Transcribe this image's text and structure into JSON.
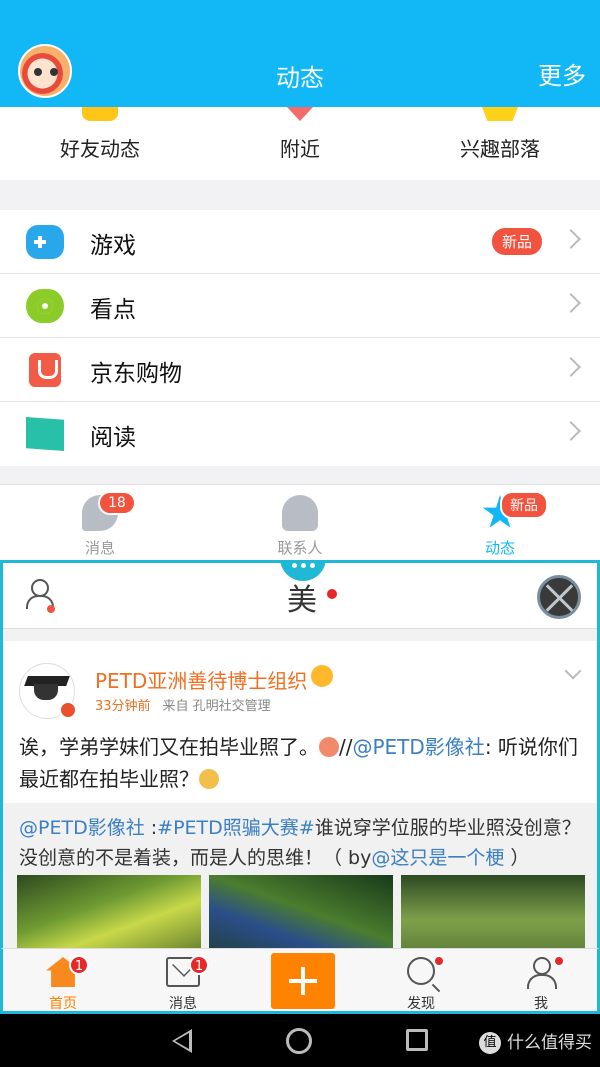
{
  "header": {
    "title": "动态",
    "more_label": "更多"
  },
  "categories": [
    {
      "label": "好友动态",
      "icon": "friends-feed-icon"
    },
    {
      "label": "附近",
      "icon": "nearby-icon"
    },
    {
      "label": "兴趣部落",
      "icon": "tribe-icon"
    }
  ],
  "list": [
    {
      "label": "游戏",
      "badge": "新品",
      "icon": "gamepad-icon"
    },
    {
      "label": "看点",
      "badge": "",
      "icon": "eye-icon"
    },
    {
      "label": "京东购物",
      "badge": "",
      "icon": "jd-shopping-icon"
    },
    {
      "label": "阅读",
      "badge": "",
      "icon": "book-icon"
    }
  ],
  "qq_tabs": [
    {
      "label": "消息",
      "badge": "18",
      "active": false
    },
    {
      "label": "联系人",
      "badge": "",
      "active": false
    },
    {
      "label": "动态",
      "badge": "新品",
      "active": true
    }
  ],
  "weibo": {
    "title": "美",
    "post": {
      "user": "PETD亚洲善待博士组织",
      "time": "33分钟前",
      "source": "来自 孔明社交管理",
      "text_before": "诶，学弟学妹们又在拍毕业照了。",
      "text_sep": "//",
      "mention": "@PETD影像社",
      "text_after": ": 听说你们最近都在拍毕业照？",
      "repost_mention": "@PETD影像社",
      "repost_sep": " :",
      "repost_tag": "#PETD照骗大赛#",
      "repost_body": "谁说穿学位服的毕业照没创意？没创意的不是着装，而是人的思维！（ by",
      "repost_author": "@这只是一个梗",
      "repost_end": " ）"
    },
    "nav": [
      {
        "label": "首页",
        "badge": "1"
      },
      {
        "label": "消息",
        "badge": "1"
      },
      {
        "label": "",
        "badge": ""
      },
      {
        "label": "发现",
        "badge": ""
      },
      {
        "label": "我",
        "badge": ""
      }
    ]
  },
  "watermark": {
    "badge": "值",
    "text": "什么值得买"
  },
  "colors": {
    "qq_blue": "#12b7f5",
    "weibo_orange": "#ff8200",
    "badge_red": "#f1533f",
    "panel_border": "#1fb8d6"
  }
}
